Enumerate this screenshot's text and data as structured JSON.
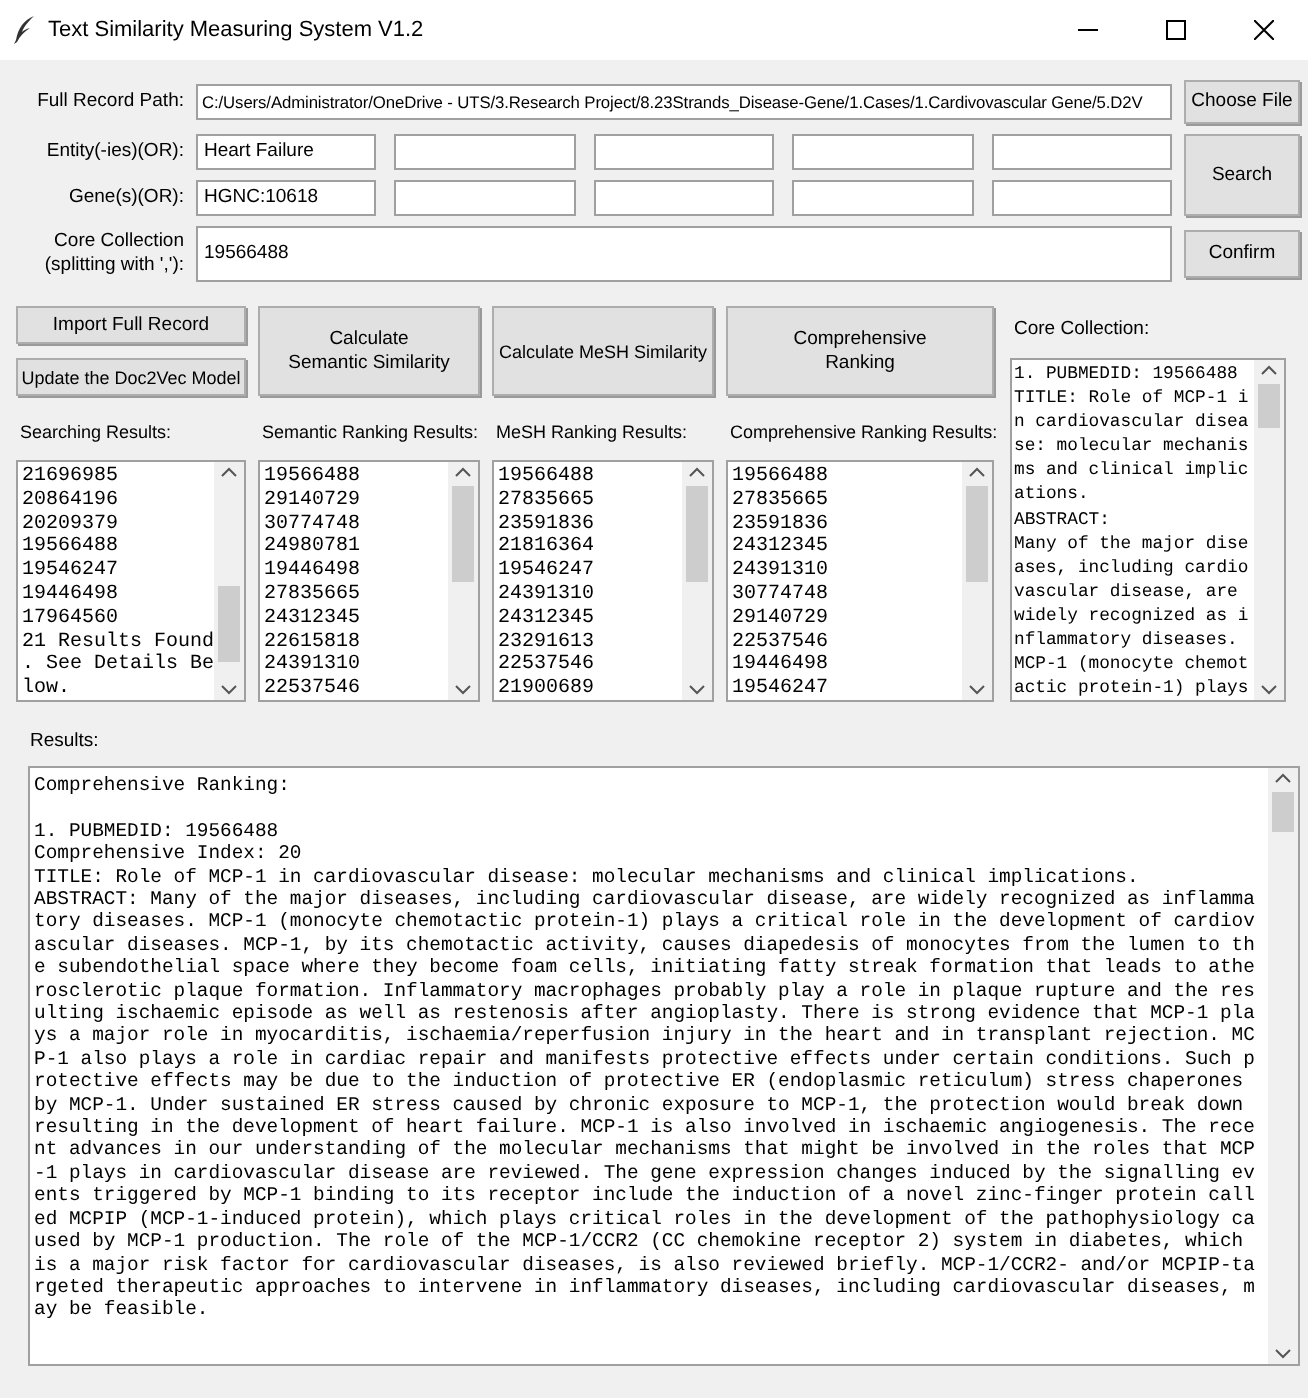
{
  "window": {
    "title": "Text Similarity Measuring System V1.2"
  },
  "form": {
    "path": {
      "label": "Full Record Path:",
      "value": "C:/Users/Administrator/OneDrive - UTS/3.Research Project/8.23Strands_Disease-Gene/1.Cases/1.Cardivovascular Gene/5.D2V"
    },
    "choose_button": "Choose File",
    "entities": {
      "label": "Entity(-ies)(OR):",
      "values": [
        "Heart Failure"
      ]
    },
    "genes": {
      "label": "Gene(s)(OR):",
      "values": [
        "HGNC:10618"
      ]
    },
    "search_button": "Search",
    "core": {
      "label_lines": [
        "Core Collection",
        "(splitting with ',')"
      ],
      "label_end": ":",
      "value": "19566488"
    },
    "confirm_button": "Confirm"
  },
  "actions": {
    "import": "Import Full Record",
    "update": "Update the Doc2Vec Model",
    "semantic": [
      "Calculate",
      "Semantic Similarity"
    ],
    "mesh": "Calculate MeSH Similarity",
    "comprehensive": [
      "Comprehensive",
      "Ranking"
    ]
  },
  "lists": [
    {
      "label": "Searching Results:",
      "lines": [
        "21696985",
        "20864196",
        "20209379",
        "19566488",
        "19546247",
        "19446498",
        "17964560",
        "21 Results Found",
        ". See Details Be",
        "low."
      ]
    },
    {
      "label": "Semantic Ranking Results:",
      "lines": [
        "19566488",
        "29140729",
        "30774748",
        "24980781",
        "19446498",
        "27835665",
        "24312345",
        "22615818",
        "24391310",
        "22537546"
      ]
    },
    {
      "label": "MeSH Ranking Results:",
      "lines": [
        "19566488",
        "27835665",
        "23591836",
        "21816364",
        "19546247",
        "24391310",
        "24312345",
        "23291613",
        "22537546",
        "21900689"
      ]
    },
    {
      "label": "Comprehensive Ranking Results:",
      "lines": [
        "19566488",
        "27835665",
        "23591836",
        "24312345",
        "24391310",
        "30774748",
        "29140729",
        "22537546",
        "19446498",
        "19546247"
      ]
    }
  ],
  "core_panel": {
    "label": "Core Collection:",
    "lines": [
      "1. PUBMEDID: 19566488",
      "TITLE: Role of MCP-1 i",
      "n cardiovascular disea",
      "se: molecular mechanis",
      "ms and clinical implic",
      "ations.",
      "ABSTRACT:",
      "Many of the major dise",
      "ases, including cardio",
      "vascular disease, are",
      "widely recognized as i",
      "nflammatory diseases.",
      "MCP-1 (monocyte chemot",
      "actic protein-1) plays"
    ]
  },
  "results": {
    "label": "Results:",
    "heading": "Comprehensive Ranking:",
    "lines": [
      "1. PUBMEDID: 19566488",
      "Comprehensive Index: 20",
      "TITLE: Role of MCP-1 in cardiovascular disease: molecular mechanisms and clinical implications.",
      "ABSTRACT: Many of the major diseases, including cardiovascular disease, are widely recognized as inflamma",
      "tory diseases. MCP-1 (monocyte chemotactic protein-1) plays a critical role in the development of cardiov",
      "ascular diseases. MCP-1, by its chemotactic activity, causes diapedesis of monocytes from the lumen to th",
      "e subendothelial space where they become foam cells, initiating fatty streak formation that leads to athe",
      "rosclerotic plaque formation. Inflammatory macrophages probably play a role in plaque rupture and the res",
      "ulting ischaemic episode as well as restenosis after angioplasty. There is strong evidence that MCP-1 pla",
      "ys a major role in myocarditis, ischaemia/reperfusion injury in the heart and in transplant rejection. MC",
      "P-1 also plays a role in cardiac repair and manifests protective effects under certain conditions. Such p",
      "rotective effects may be due to the induction of protective ER (endoplasmic reticulum) stress chaperones",
      "by MCP-1. Under sustained ER stress caused by chronic exposure to MCP-1, the protection would break down",
      "resulting in the development of heart failure. MCP-1 is also involved in ischaemic angiogenesis. The rece",
      "nt advances in our understanding of the molecular mechanisms that might be involved in the roles that MCP",
      "-1 plays in cardiovascular disease are reviewed. The gene expression changes induced by the signalling ev",
      "ents triggered by MCP-1 binding to its receptor include the induction of a novel zinc-finger protein call",
      "ed MCPIP (MCP-1-induced protein), which plays critical roles in the development of the pathophysiology ca",
      "used by MCP-1 production. The role of the MCP-1/CCR2 (CC chemokine receptor 2) system in diabetes, which",
      "is a major risk factor for cardiovascular diseases, is also reviewed briefly. MCP-1/CCR2- and/or MCPIP-ta",
      "rgeted therapeutic approaches to intervene in inflammatory diseases, including cardiovascular diseases, m",
      "ay be feasible."
    ]
  }
}
